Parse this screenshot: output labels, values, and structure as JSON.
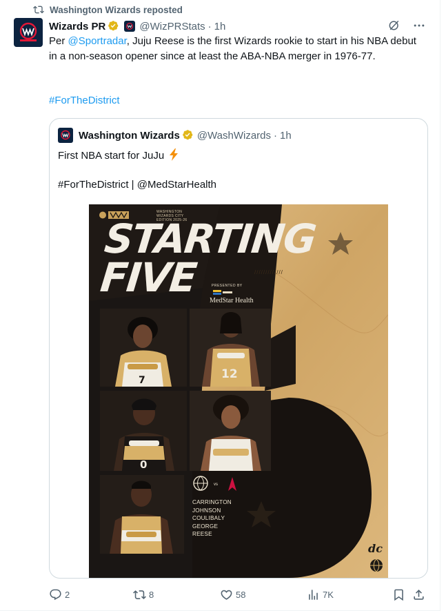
{
  "repost_label": "Washington Wizards reposted",
  "post": {
    "author_name": "Wizards PR",
    "handle": "@WizPRStats",
    "separator": "·",
    "time": "1h",
    "text_before": "Per ",
    "mention": "@Sportradar",
    "text_after": ", Juju Reese is the first Wizards rookie to start in his NBA debut in a non-season opener since at least the ABA-NBA merger in 1976-77.",
    "hashtag": "#ForTheDistrict"
  },
  "quote": {
    "author_name": "Washington Wizards",
    "handle": "@WashWizards",
    "separator": "·",
    "time": "1h",
    "line1": "First NBA start for JuJu",
    "line2": "#ForTheDistrict | @MedStarHealth",
    "poster": {
      "title_line1": "STARTING",
      "title_line2": "FIVE",
      "edition_text": "WASHINGTON WIZARDS CITY EDITION 2025-26",
      "presented_by": "PRESENTED BY",
      "sponsor": "MedStar Health",
      "slash_marks": "/////////////",
      "starters": [
        "CARRINGTON",
        "JOHNSON",
        "COULIBALY",
        "GEORGE",
        "REESE"
      ],
      "matchup_vs": "vs",
      "jersey_numbers": [
        "7",
        "12",
        "0"
      ],
      "brand_mark": "dc"
    }
  },
  "actions": {
    "replies": "2",
    "reposts": "8",
    "likes": "58",
    "views": "7K"
  },
  "colors": {
    "link": "#1d9bf0",
    "secondary_text": "#536471",
    "border": "#cfd9de",
    "verified_gold": "#e2b719",
    "wizards_navy": "#0c2340",
    "wizards_red": "#e31837"
  }
}
